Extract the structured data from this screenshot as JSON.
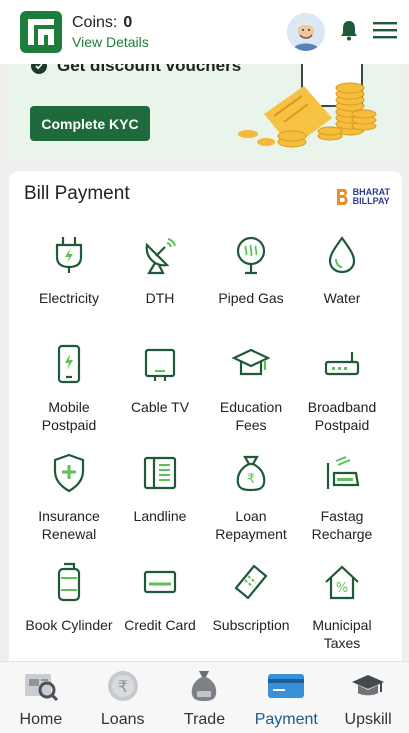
{
  "header": {
    "coins_label": "Coins:",
    "coins_value": "0",
    "view_details": "View Details"
  },
  "kyc": {
    "headline": "Get discount vouchers",
    "button": "Complete KYC"
  },
  "bill": {
    "title": "Bill Payment",
    "bbps_line1": "BHARAT",
    "bbps_line2": "BILLPAY",
    "items": [
      {
        "label": "Electricity",
        "icon": "plug-icon"
      },
      {
        "label": "DTH",
        "icon": "satellite-dish-icon"
      },
      {
        "label": "Piped Gas",
        "icon": "gas-icon"
      },
      {
        "label": "Water",
        "icon": "water-drop-icon"
      },
      {
        "label": "Mobile Postpaid",
        "icon": "mobile-icon"
      },
      {
        "label": "Cable TV",
        "icon": "tv-icon"
      },
      {
        "label": "Education Fees",
        "icon": "graduation-cap-icon"
      },
      {
        "label": "Broadband Postpaid",
        "icon": "router-icon"
      },
      {
        "label": "Insurance Renewal",
        "icon": "shield-plus-icon"
      },
      {
        "label": "Landline",
        "icon": "landline-icon"
      },
      {
        "label": "Loan Repayment",
        "icon": "money-bag-icon"
      },
      {
        "label": "Fastag Recharge",
        "icon": "fastag-icon"
      },
      {
        "label": "Book Cylinder",
        "icon": "cylinder-icon"
      },
      {
        "label": "Credit Card",
        "icon": "credit-card-icon"
      },
      {
        "label": "Subscription",
        "icon": "ticket-icon"
      },
      {
        "label": "Municipal Taxes",
        "icon": "house-percent-icon"
      }
    ]
  },
  "nav": {
    "items": [
      {
        "label": "Home",
        "icon": "home-icon"
      },
      {
        "label": "Loans",
        "icon": "rupee-coin-icon"
      },
      {
        "label": "Trade",
        "icon": "money-bag-icon"
      },
      {
        "label": "Payment",
        "icon": "card-icon"
      },
      {
        "label": "Upskill",
        "icon": "graduation-cap-icon"
      }
    ],
    "active": "Payment"
  },
  "colors": {
    "brand_green": "#1e7d3b",
    "icon_green": "#1e5a38",
    "accent_light_green": "#5fbf5a"
  }
}
